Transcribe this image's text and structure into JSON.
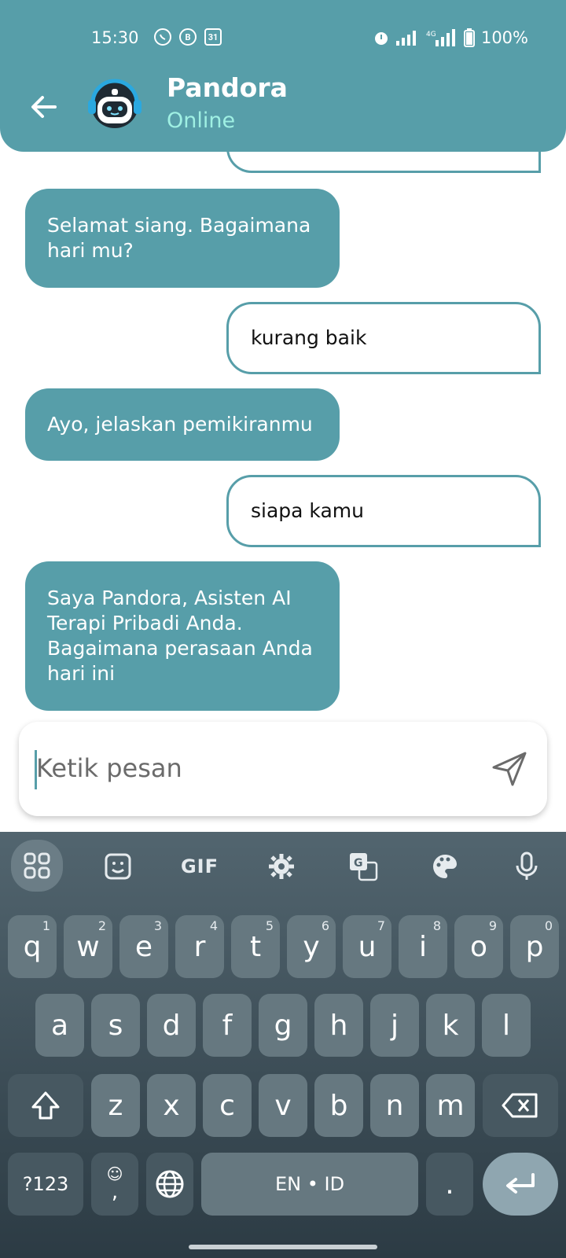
{
  "status_bar": {
    "time": "15:30",
    "left_icons": [
      "whatsapp-icon",
      "b-app-icon",
      "calendar-31-icon"
    ],
    "calendar_text": "31",
    "b_text": "B",
    "right_icons": [
      "alarm-icon",
      "signal-icon",
      "4g-signal-icon",
      "battery-icon"
    ],
    "battery": "100%"
  },
  "header": {
    "title": "Pandora",
    "subtitle": "Online",
    "colors": {
      "primary": "#579ea9",
      "online": "#9ff0e3"
    }
  },
  "messages": [
    {
      "sender": "bot",
      "text": "Selamat siang. Bagaimana hari mu?"
    },
    {
      "sender": "user",
      "text": "kurang baik"
    },
    {
      "sender": "bot",
      "text": "Ayo, jelaskan pemikiranmu"
    },
    {
      "sender": "user",
      "text": "siapa kamu"
    },
    {
      "sender": "bot",
      "text": "Saya Pandora, Asisten AI Terapi Pribadi Anda. Bagaimana perasaan Anda hari ini"
    }
  ],
  "input": {
    "placeholder": "Ketik pesan"
  },
  "keyboard": {
    "toolbar": [
      "apps-grid-icon",
      "sticker-icon",
      "GIF",
      "settings-icon",
      "translate-icon",
      "palette-icon",
      "mic-icon"
    ],
    "gif_label": "GIF",
    "row1": [
      {
        "k": "q",
        "h": "1"
      },
      {
        "k": "w",
        "h": "2"
      },
      {
        "k": "e",
        "h": "3"
      },
      {
        "k": "r",
        "h": "4"
      },
      {
        "k": "t",
        "h": "5"
      },
      {
        "k": "y",
        "h": "6"
      },
      {
        "k": "u",
        "h": "7"
      },
      {
        "k": "i",
        "h": "8"
      },
      {
        "k": "o",
        "h": "9"
      },
      {
        "k": "p",
        "h": "0"
      }
    ],
    "row2": [
      "a",
      "s",
      "d",
      "f",
      "g",
      "h",
      "j",
      "k",
      "l"
    ],
    "row3": [
      "z",
      "x",
      "c",
      "v",
      "b",
      "n",
      "m"
    ],
    "symbols_label": "?123",
    "emoji_comma": ",",
    "space_label": "EN • ID",
    "period": "."
  }
}
